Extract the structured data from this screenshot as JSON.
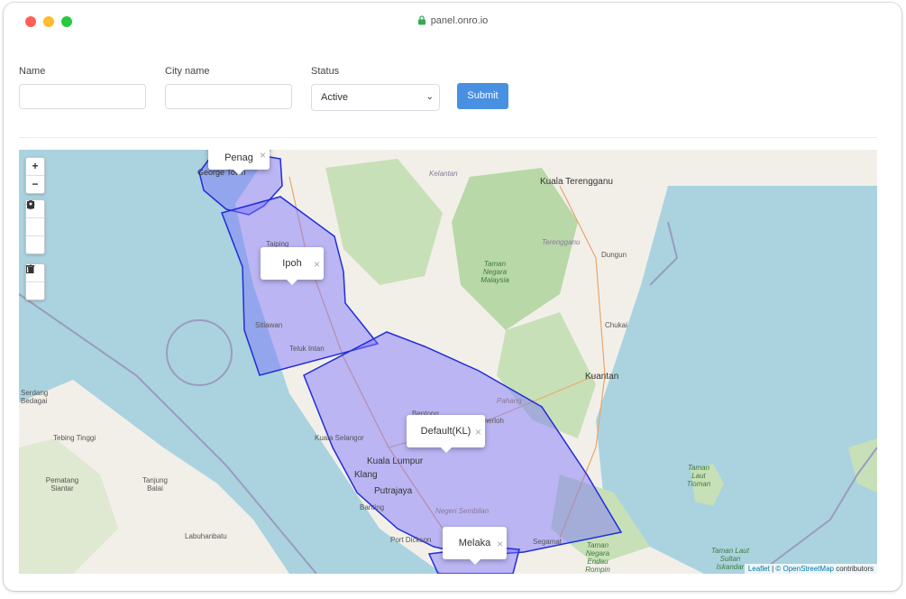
{
  "browser": {
    "url": "panel.onro.io"
  },
  "form": {
    "name_label": "Name",
    "city_label": "City name",
    "status_label": "Status",
    "status_value": "Active",
    "submit_label": "Submit"
  },
  "map": {
    "zoom_in": "+",
    "zoom_out": "−",
    "popups": [
      "Penag",
      "Ipoh",
      "Default(KL)",
      "Melaka"
    ],
    "places": [
      "Kuala Terengganu",
      "Kelantan",
      "Terengganu",
      "Dungun",
      "Taman Negara Malaysia",
      "Chukai",
      "Kuantan",
      "Taiping",
      "Sitiawan",
      "Teluk Intan",
      "Bentong",
      "Kuala Selangor",
      "Kuala Lumpur",
      "Klang",
      "Putrajaya",
      "Banting",
      "Negeri Sembilan",
      "Port Dickson",
      "Segamat",
      "Taman Negara Endau Rompin",
      "Pahang",
      "Temerloh",
      "Tebing Tinggi",
      "Pematang Siantar",
      "Tanjung Balai",
      "Labuhanbatu",
      "Serdang Bedagai",
      "Taman Laut Tioman",
      "Taman Laut Sultan Iskandar",
      "George Town"
    ],
    "attribution_leaflet": "Leaflet",
    "attribution_osm": "© OpenStreetMap",
    "attribution_rest": "contributors"
  }
}
